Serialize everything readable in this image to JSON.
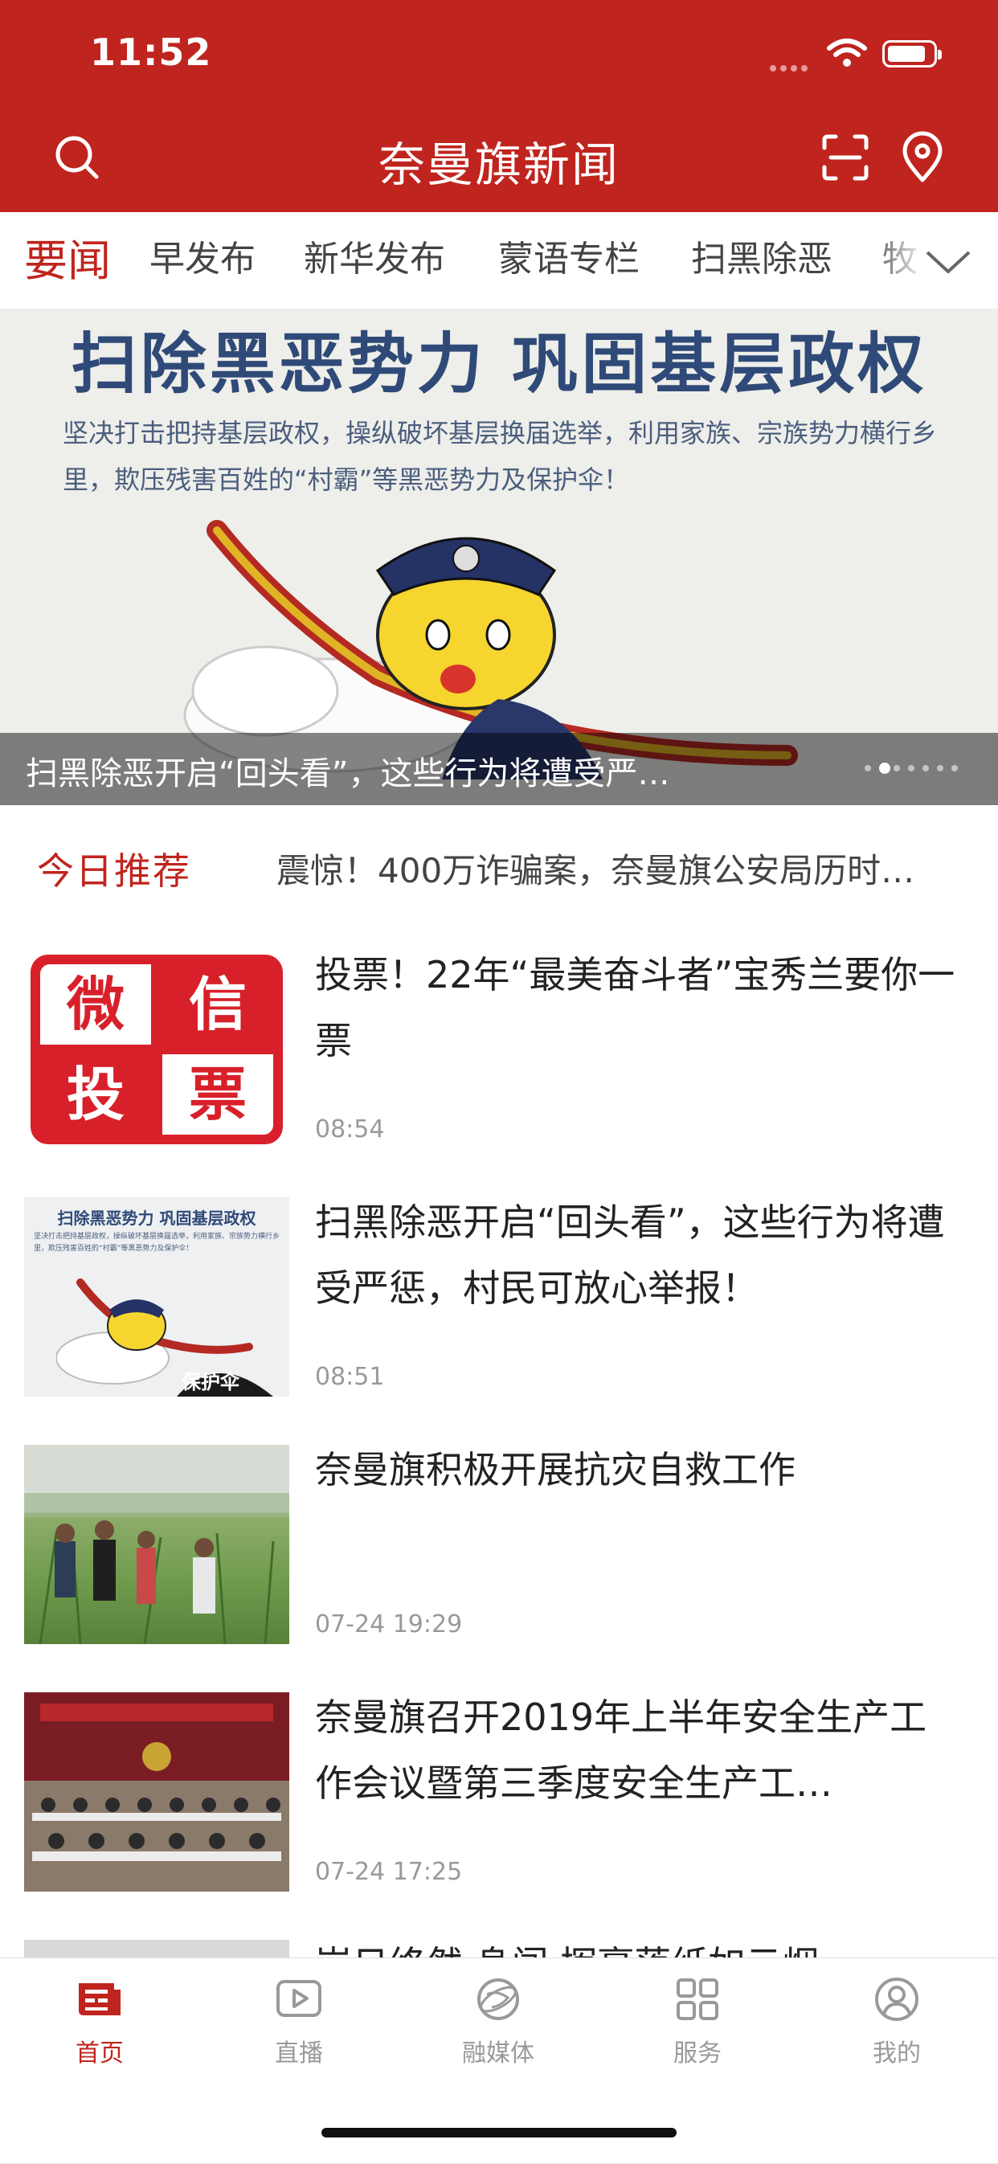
{
  "status": {
    "time": "11:52"
  },
  "header": {
    "title": "奈曼旗新闻"
  },
  "tabs": [
    {
      "label": "要闻"
    },
    {
      "label": "早发布"
    },
    {
      "label": "新华发布"
    },
    {
      "label": "蒙语专栏"
    },
    {
      "label": "扫黑除恶"
    },
    {
      "label": "牧"
    }
  ],
  "banner": {
    "heading": "扫除黑恶势力  巩固基层政权",
    "body": "坚决打击把持基层政权，操纵破坏基层换届选举，利用家族、宗族势力横行乡里，欺压残害百姓的“村霸”等黑恶势力及保护伞！",
    "caption": "扫黑除恶开启“回头看”，这些行为将遭受严…",
    "slide_count": 7,
    "active_slide": 1
  },
  "today": {
    "label": "今日推荐",
    "text": "震惊！400万诈骗案，奈曼旗公安局历时…"
  },
  "news": [
    {
      "title": "投票！22年“最美奋斗者”宝秀兰要你一票",
      "time": "08:54",
      "thumb": [
        "微",
        "信",
        "投",
        "票"
      ]
    },
    {
      "title": "扫黑除恶开启“回头看”，这些行为将遭受严惩，村民可放心举报！",
      "time": "08:51",
      "thumb_heading": "扫除黑恶势力  巩固基层政权",
      "thumb_body": "坚决打击把持基层政权，操纵破坏基层换届选举，利用家族、宗族势力横行乡里，欺压残害百姓的“村霸”等黑恶势力及保护伞！",
      "thumb_umbrella": "保护伞"
    },
    {
      "title": "奈曼旗积极开展抗灾自救工作",
      "time": "07-24 19:29"
    },
    {
      "title": "奈曼旗召开2019年上半年安全生产工作会议暨第三季度安全生产工…",
      "time": "07-24 17:25"
    },
    {
      "title": "岗日终然  身闯 挥毫落纸如云烟"
    }
  ],
  "tabbar": [
    {
      "label": "首页"
    },
    {
      "label": "直播"
    },
    {
      "label": "融媒体"
    },
    {
      "label": "服务"
    },
    {
      "label": "我的"
    }
  ],
  "colors": {
    "brand": "#C0241E",
    "muted": "#999999"
  }
}
